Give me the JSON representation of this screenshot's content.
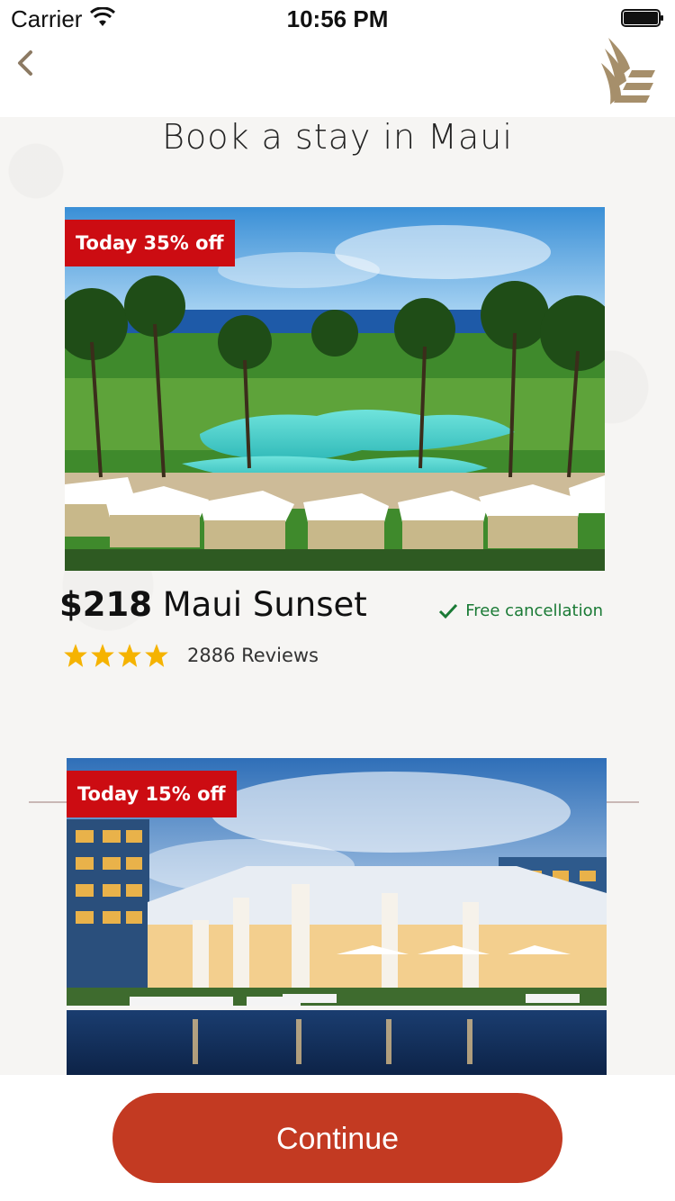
{
  "status_bar": {
    "carrier": "Carrier",
    "time": "10:56 PM"
  },
  "nav": {
    "back_icon": "chevron-left-icon",
    "logo_icon": "airline-bird-logo",
    "accent_color": "#8c7a63"
  },
  "page": {
    "title": "Book a stay in Maui"
  },
  "hotels": [
    {
      "badge": "Today 35% off",
      "price": "$218",
      "name": "Maui Sunset",
      "cancellation": "Free cancellation",
      "rating_stars": 4,
      "reviews": "2886 Reviews",
      "photo": "resort-pool-palm-trees"
    },
    {
      "badge": "Today 15% off",
      "photo": "hotel-lobby-pool-dusk"
    }
  ],
  "footer": {
    "continue_label": "Continue"
  },
  "colors": {
    "badge_red": "#cc0c12",
    "button_red": "#c33a22",
    "cancel_green": "#1a7a35",
    "star_gold": "#f5b300"
  }
}
